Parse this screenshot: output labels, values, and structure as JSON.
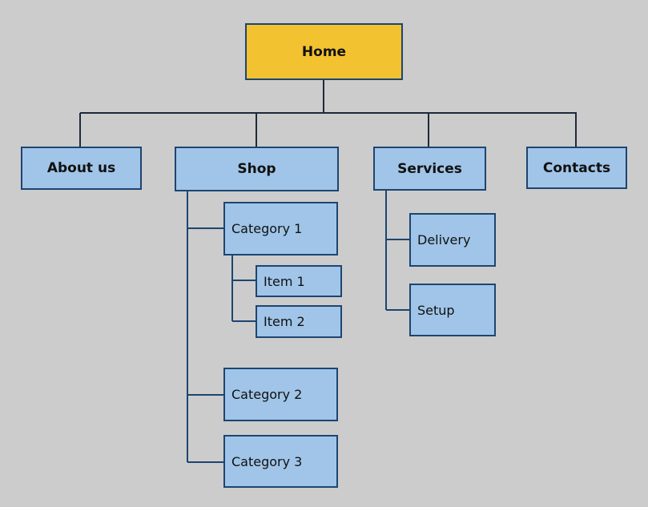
{
  "colors": {
    "background": "#cccccc",
    "node": "#a0c5e8",
    "root": "#f2c230",
    "border": "#1d4570"
  },
  "root": {
    "label": "Home"
  },
  "sections": {
    "about": {
      "label": "About us"
    },
    "shop": {
      "label": "Shop",
      "children": {
        "cat1": {
          "label": "Category 1",
          "children": {
            "item1": {
              "label": "Item 1"
            },
            "item2": {
              "label": "Item 2"
            }
          }
        },
        "cat2": {
          "label": "Category 2"
        },
        "cat3": {
          "label": "Category 3"
        }
      }
    },
    "services": {
      "label": "Services",
      "children": {
        "delivery": {
          "label": "Delivery"
        },
        "setup": {
          "label": "Setup"
        }
      }
    },
    "contacts": {
      "label": "Contacts"
    }
  }
}
